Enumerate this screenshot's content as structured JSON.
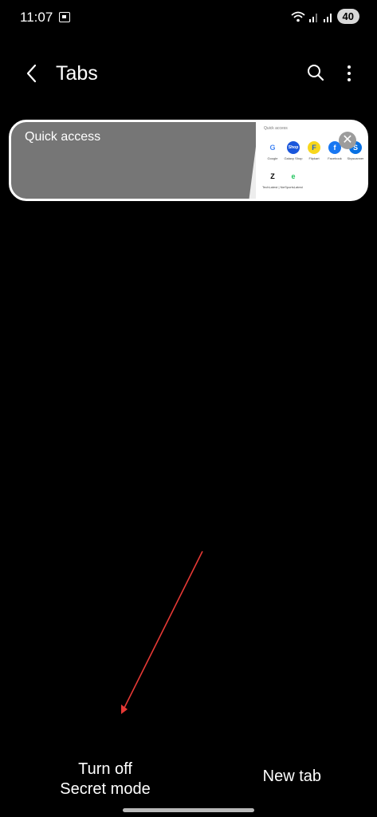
{
  "status_bar": {
    "time": "11:07",
    "battery": "40"
  },
  "header": {
    "title": "Tabs"
  },
  "tab_card": {
    "title": "Quick access",
    "preview_label": "Quick access",
    "shortcuts": [
      {
        "name": "Google",
        "letter": "G",
        "color": "#ffffff",
        "text_color": "#4285F4"
      },
      {
        "name": "Galaxy Shop",
        "letter": "Shop",
        "color": "#1a56db",
        "text_color": "#ffffff"
      },
      {
        "name": "Flipkart",
        "letter": "F",
        "color": "#f8d71c",
        "text_color": "#1e5fd8"
      },
      {
        "name": "Facebook",
        "letter": "f",
        "color": "#1877F2",
        "text_color": "#ffffff"
      },
      {
        "name": "Skyscanner",
        "letter": "S",
        "color": "#0770e3",
        "text_color": "#ffffff"
      },
      {
        "name": "TechLatest | News, G...",
        "letter": "Z",
        "color": "#ffffff",
        "text_color": "#000000"
      },
      {
        "name": "eSportsLatest | News,...",
        "letter": "e",
        "color": "#ffffff",
        "text_color": "#22c55e"
      }
    ]
  },
  "bottom": {
    "secret_line1": "Turn off",
    "secret_line2": "Secret mode",
    "new_tab": "New tab"
  }
}
